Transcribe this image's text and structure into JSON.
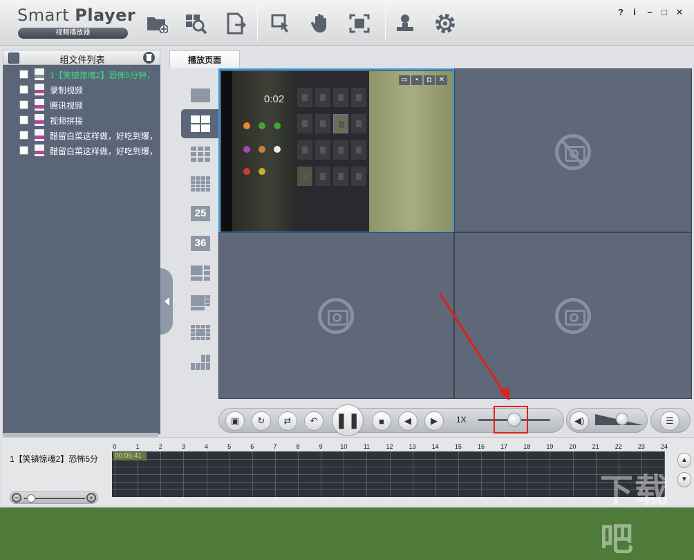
{
  "app": {
    "title_part1": "Smart ",
    "title_part2": "Player",
    "subtitle": "视频播放器"
  },
  "window_controls": [
    "?",
    "i",
    "–",
    "□",
    "✕"
  ],
  "toolbar": {
    "icons": [
      "add-folder-icon",
      "search-window-icon",
      "export-file-icon",
      "select-cursor-icon",
      "hand-icon",
      "fullscreen-icon",
      "user-stamp-icon",
      "settings-gear-icon"
    ]
  },
  "left_panel": {
    "title": "组文件列表",
    "files": [
      {
        "label": "1【笑镇惊魂2】恐怖5分钟，",
        "type": "mov",
        "active": true
      },
      {
        "label": "录制视频",
        "type": "mp4",
        "active": false
      },
      {
        "label": "腾讯视频",
        "type": "mp4",
        "active": false
      },
      {
        "label": "视频拼接",
        "type": "mp4",
        "active": false
      },
      {
        "label": "醋留白菜这样做，好吃到爆，",
        "type": "mp4",
        "active": false
      },
      {
        "label": "醋留白菜这样做，好吃到爆，",
        "type": "mp4",
        "active": false
      }
    ]
  },
  "main": {
    "tab_label": "播放页面",
    "layout_options": [
      "1x1",
      "2x2",
      "3x3",
      "4x4",
      "25",
      "36",
      "1+5",
      "1+7",
      "1+12",
      "1+16"
    ],
    "layout_selected": "2x2",
    "video_time": "0:02"
  },
  "controls": {
    "speed_label": "1X",
    "speed_value": 0.5,
    "volume_value": 0.55
  },
  "timeline": {
    "track_name": "1【笑镇惊魂2】恐怖5分",
    "current_time": "00:06:41",
    "hours": [
      "0",
      "1",
      "2",
      "3",
      "4",
      "5",
      "6",
      "7",
      "8",
      "9",
      "10",
      "11",
      "12",
      "13",
      "14",
      "15",
      "16",
      "17",
      "18",
      "19",
      "20",
      "21",
      "22",
      "23",
      "24"
    ]
  },
  "watermark": "下载吧",
  "colors": {
    "accent_select": "#2f9be3",
    "active_file": "#35e07a",
    "annotation_red": "#e0201a"
  }
}
